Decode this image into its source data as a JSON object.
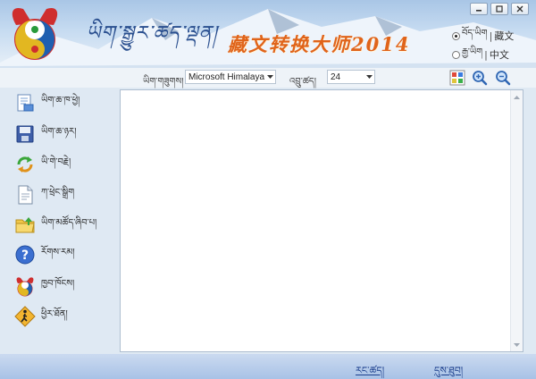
{
  "header": {
    "tibetan_calligraphy": "ཡིག་སྒྱུར་ཚད་ལྡན།",
    "app_title": "藏文转换大师2014",
    "window_buttons": [
      "minimize",
      "maximize",
      "close"
    ],
    "language_options": [
      {
        "tibetan": "བོད་ཡིག",
        "separator": "|",
        "chinese": "藏文",
        "selected": true
      },
      {
        "tibetan": "རྒྱ་ཡིག",
        "separator": "|",
        "chinese": "中文",
        "selected": false
      }
    ]
  },
  "toolbar": {
    "font_label": "ཡིག་གཟུགས།",
    "font_value": "Microsoft Himalaya",
    "size_label": "འབྲུ་ཚད།",
    "size_value": "24",
    "icons": [
      "color-grid-icon",
      "zoom-in-icon",
      "zoom-out-icon"
    ]
  },
  "sidebar": {
    "items": [
      {
        "icon": "open-file-icon",
        "label": "ཡིག་ཆ་ཁ་ཕྱེ།"
      },
      {
        "icon": "save-disk-icon",
        "label": "ཡིག་ཆ་ཉར།"
      },
      {
        "icon": "convert-arrows-icon",
        "label": "ཡི་གེ་བརྗེ།"
      },
      {
        "icon": "document-icon",
        "label": "ཀ་ཕྲེང་སྒྲིག"
      },
      {
        "icon": "folder-icon",
        "label": "ཡིག་མཚོད་ཞིབ་པ།"
      },
      {
        "icon": "help-icon",
        "label": "རོགས་རམ།"
      },
      {
        "icon": "app-logo-icon",
        "label": "ཁྱབ་ཁོངས།"
      },
      {
        "icon": "exit-icon",
        "label": "ཕྱིར་ཐོན།"
      }
    ]
  },
  "editor": {
    "content": ""
  },
  "bottom": {
    "buttons": [
      "རང་ཚད།",
      "དུས་ཐུབ།"
    ]
  },
  "colors": {
    "title_orange": "#e0641a",
    "calligraphy_blue": "#2a4f8f",
    "banner_top": "#a9c6e6",
    "bottom_bar": "#a8c2e6",
    "background": "#dfe9f3"
  }
}
